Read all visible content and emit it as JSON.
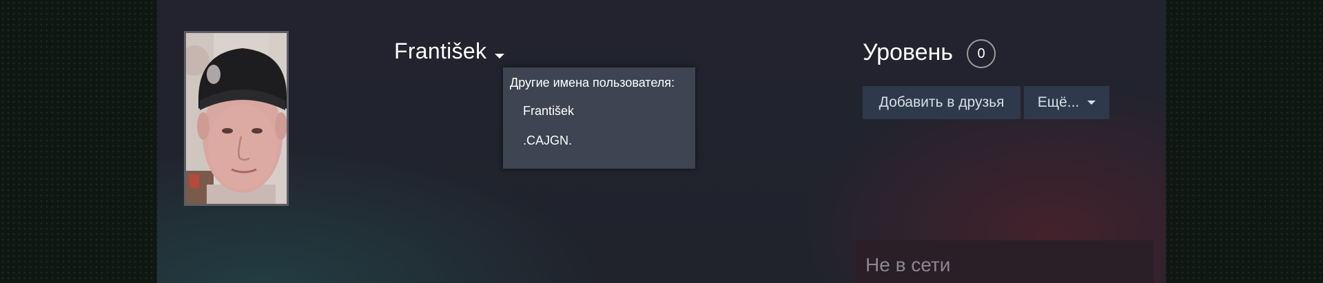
{
  "profile": {
    "persona_name": "František",
    "aliases_header": "Другие имена пользователя:",
    "aliases": [
      "František",
      ".CAJGN."
    ],
    "level_label": "Уровень",
    "level_value": "0",
    "add_friend_label": "Добавить в друзья",
    "more_label": "Ещё...",
    "status_text": "Не в сети"
  },
  "colors": {
    "page_background": "#0f1712",
    "panel_background": "#22232f",
    "dropdown_background": "#3e4451",
    "button_background": "#2e3a4b",
    "status_background": "#2a1f26"
  },
  "icons": {
    "name_dropdown": "caret-down-icon",
    "more_dropdown": "caret-down-icon"
  }
}
